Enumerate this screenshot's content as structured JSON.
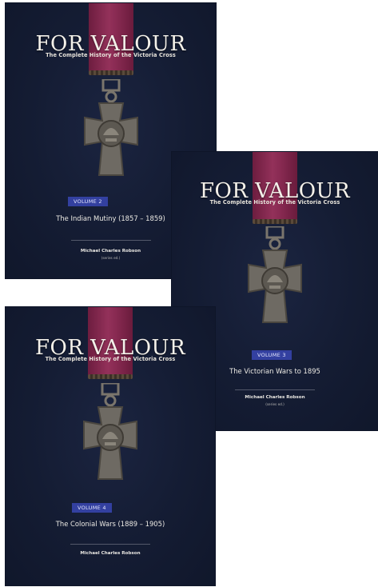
{
  "books": [
    {
      "title": "FOR VALOUR",
      "subtitle": "The Complete History of the Victoria Cross",
      "volume": "VOLUME 2",
      "volume_title": "The Indian Mutiny (1857 – 1859)",
      "author": "Michael Charles Robson",
      "author_sub": "(series ed.)"
    },
    {
      "title": "FOR VALOUR",
      "subtitle": "The Complete History of the Victoria Cross",
      "volume": "VOLUME 3",
      "volume_title": "The Victorian Wars to 1895",
      "author": "Michael Charles Robson",
      "author_sub": "(series ed.)"
    },
    {
      "title": "FOR VALOUR",
      "subtitle": "The Complete History of the Victoria Cross",
      "volume": "VOLUME 4",
      "volume_title": "The Colonial Wars (1889 – 1905)",
      "author": "Michael Charles Robson"
    }
  ],
  "colors": {
    "cover_background": "#141c33",
    "ribbon": "#8a2b53",
    "volume_badge": "#3340a0",
    "medal_bronze": "#6e6a63"
  }
}
